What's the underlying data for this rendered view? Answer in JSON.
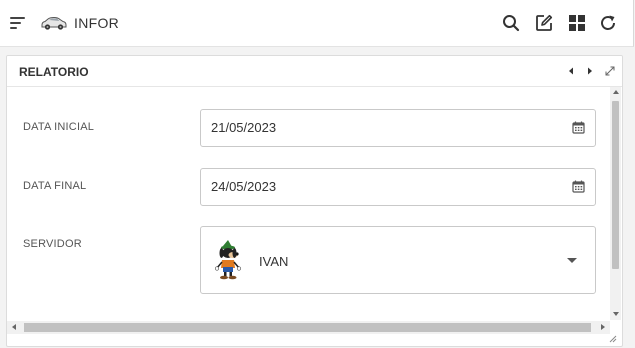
{
  "app": {
    "title": "INFOR",
    "toolbar": {
      "icons": [
        "menu-icon",
        "car-icon",
        "search-icon",
        "edit-icon",
        "grid-icon",
        "refresh-icon"
      ]
    }
  },
  "panel": {
    "title": "RELATORIO",
    "header_icons": [
      "chevron-left-icon",
      "chevron-right-icon",
      "expand-icon"
    ]
  },
  "form": {
    "start_date": {
      "label": "DATA INICIAL",
      "value": "21/05/2023"
    },
    "end_date": {
      "label": "DATA FINAL",
      "value": "24/05/2023"
    },
    "server": {
      "label": "SERVIDOR",
      "value": "IVAN"
    }
  },
  "colors": {
    "background": "#f3f3f3",
    "panel": "#ffffff",
    "border": "#c9c9c9",
    "text": "#333333",
    "scrollbar_thumb": "#c1c1c1"
  }
}
